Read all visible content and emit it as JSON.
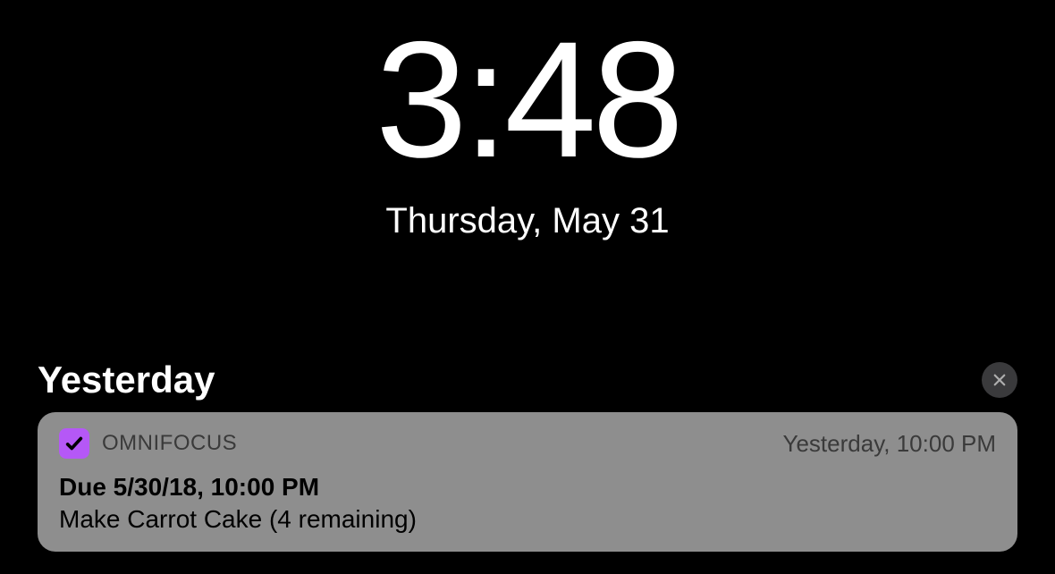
{
  "lockscreen": {
    "time": "3:48",
    "date": "Thursday, May 31"
  },
  "notifications": {
    "section_label": "Yesterday",
    "items": [
      {
        "app_name": "OMNIFOCUS",
        "timestamp": "Yesterday, 10:00 PM",
        "title": "Due 5/30/18, 10:00 PM",
        "body": "Make Carrot Cake (4 remaining)"
      }
    ]
  }
}
